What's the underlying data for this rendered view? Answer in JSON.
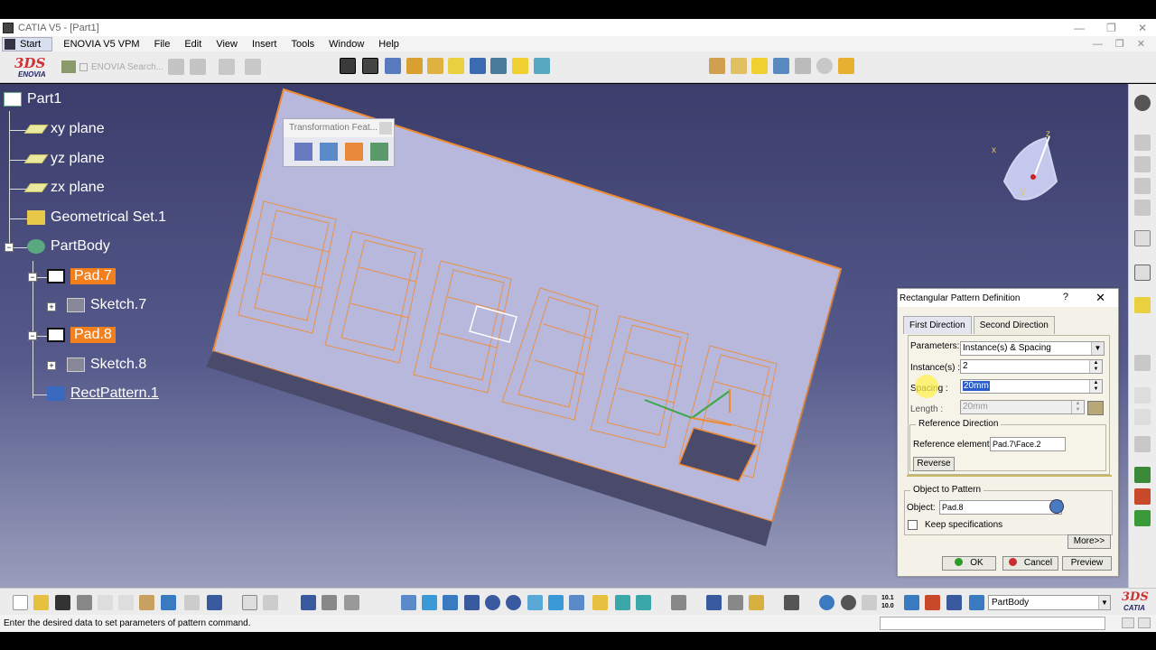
{
  "window": {
    "title": "CATIA V5 - [Part1]",
    "controls": [
      "—",
      "❐",
      "✕"
    ]
  },
  "menubar": {
    "start": "Start",
    "items": [
      "ENOVIA V5 VPM",
      "File",
      "Edit",
      "View",
      "Insert",
      "Tools",
      "Window",
      "Help"
    ],
    "doc_controls": [
      "—",
      "❐",
      "✕"
    ]
  },
  "toolbar_top": {
    "logo_text": "ENOVIA",
    "search_placeholder": "ENOVIA Search..."
  },
  "tree": {
    "root": "Part1",
    "xy": "xy plane",
    "yz": "yz plane",
    "zx": "zx plane",
    "geoset": "Geometrical Set.1",
    "partbody": "PartBody",
    "pad7": "Pad.7",
    "sketch7": "Sketch.7",
    "pad8": "Pad.8",
    "sketch8": "Sketch.8",
    "rectpattern": "RectPattern.1"
  },
  "floating_toolbar": {
    "title": "Transformation Feat..."
  },
  "compass": {
    "x_label": "x",
    "y_label": "y",
    "z_label": "z"
  },
  "dialog": {
    "title": "Rectangular Pattern Definition",
    "help": "?",
    "close": "✕",
    "tab_first": "First Direction",
    "tab_second": "Second Direction",
    "parameters_label": "Parameters:",
    "parameters_value": "Instance(s) & Spacing",
    "instances_label": "Instance(s) :",
    "instances_value": "2",
    "spacing_label": "Spacing :",
    "spacing_value": "20mm",
    "length_label": "Length :",
    "length_value": "20mm",
    "refdir_title": "Reference Direction",
    "refelem_label": "Reference element:",
    "refelem_value": "Pad.7\\Face.2",
    "reverse_label": "Reverse",
    "object_title": "Object to Pattern",
    "object_label": "Object:",
    "object_value": "Pad.8",
    "keep_label": "Keep specifications",
    "more_label": "More>>",
    "ok_label": "OK",
    "cancel_label": "Cancel",
    "preview_label": "Preview"
  },
  "toolbar_bottom": {
    "body_select": "PartBody",
    "scale_label": "10.1 10.0"
  },
  "statusbar": {
    "message": "Enter the desired data to set parameters of pattern command."
  },
  "colors": {
    "highlight": "#f2801e",
    "geometry": "#f08a32",
    "background_top": "#3b3d6b",
    "ok_green": "#2a9a2a",
    "cancel_red": "#c83030"
  }
}
